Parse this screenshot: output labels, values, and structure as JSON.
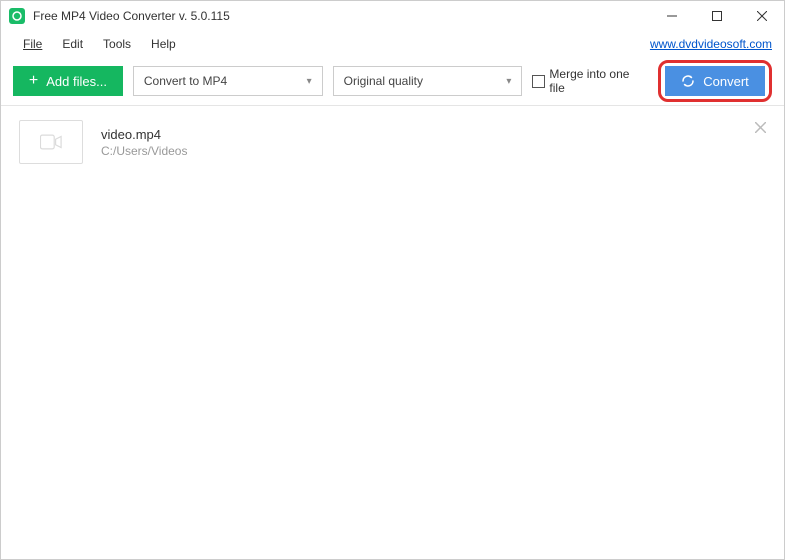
{
  "titlebar": {
    "title": "Free MP4 Video Converter v. 5.0.115"
  },
  "menubar": {
    "items": [
      "File",
      "Edit",
      "Tools",
      "Help"
    ],
    "website": "www.dvdvideosoft.com"
  },
  "toolbar": {
    "add_files": "Add files...",
    "format_dropdown": "Convert to MP4",
    "quality_dropdown": "Original quality",
    "merge_label": "Merge into one file",
    "convert": "Convert"
  },
  "files": [
    {
      "name": "video.mp4",
      "path": "C:/Users/Videos"
    }
  ]
}
